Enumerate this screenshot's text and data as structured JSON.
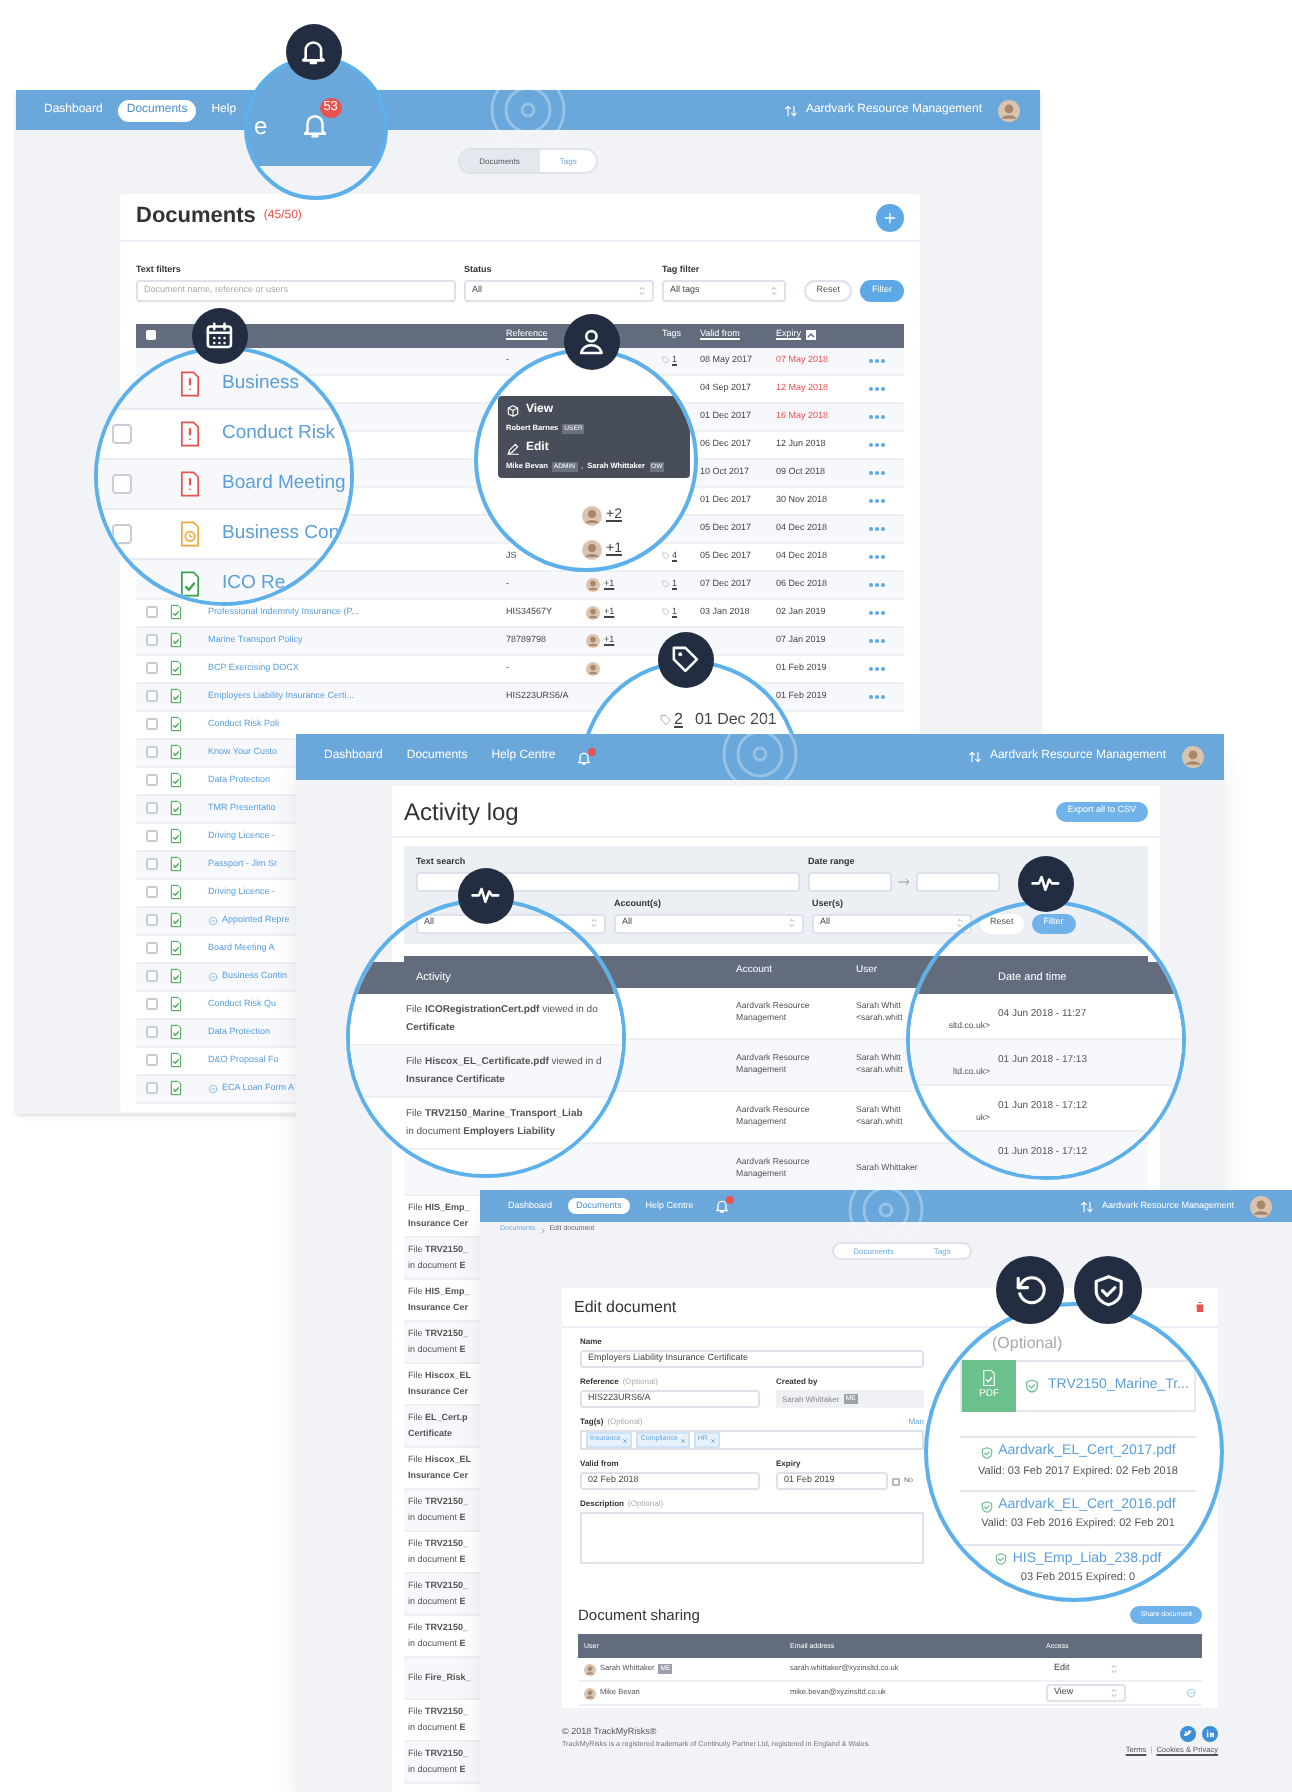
{
  "documents_window": {
    "nav": {
      "links": [
        {
          "label": "Dashboard",
          "selected": false
        },
        {
          "label": "Documents",
          "selected": true
        },
        {
          "label": "Help",
          "selected": false
        }
      ],
      "account": "Aardvark Resource Management"
    },
    "view_toggle": [
      {
        "label": "Documents",
        "selected": true
      },
      {
        "label": "Tags",
        "selected": false
      }
    ],
    "title": "Documents",
    "count": "(45/50)",
    "filters": {
      "text_label": "Text filters",
      "text_placeholder": "Document name, reference or users",
      "status_label": "Status",
      "status_value": "All",
      "tag_label": "Tag filter",
      "tag_value": "All tags",
      "reset": "Reset",
      "filter": "Filter"
    },
    "select_all_checked": false,
    "columns": {
      "reference": "Reference",
      "tags": "Tags",
      "valid_from": "Valid from",
      "expiry": "Expiry"
    },
    "rows": [
      {
        "reference": "-",
        "tags": "1",
        "valid_from": "08 May 2017",
        "expiry": "07 May 2018",
        "expired": true
      },
      {
        "valid_from": "04 Sep 2017",
        "expiry": "12 May 2018",
        "expired": true
      },
      {
        "valid_from": "01 Dec 2017",
        "expiry": "16 May 2018",
        "expired": true
      },
      {
        "valid_from": "06 Dec 2017",
        "expiry": "12 Jun 2018",
        "expired": false
      },
      {
        "valid_from": "10 Oct 2017",
        "expiry": "09 Oct 2018",
        "expired": false
      },
      {
        "valid_from": "01 Dec 2017",
        "expiry": "30 Nov 2018",
        "expired": false
      },
      {
        "valid_from": "05 Dec 2017",
        "expiry": "04 Dec 2018",
        "expired": false
      },
      {
        "reference": "JS",
        "tags": "4",
        "valid_from": "05 Dec 2017",
        "expiry": "04 Dec 2018",
        "expired": false
      },
      {
        "reference": "-",
        "users": "+1",
        "tags": "1",
        "valid_from": "07 Dec 2017",
        "expiry": "06 Dec 2018",
        "expired": false
      },
      {
        "checked": false,
        "kind": "valid",
        "name": "Professional Indemnity Insurance (P...",
        "reference": "HIS34567Y",
        "users": "+1",
        "tags": "1",
        "valid_from": "03 Jan 2018",
        "expiry": "02 Jan 2019",
        "expired": false
      },
      {
        "checked": false,
        "kind": "valid",
        "name": "Marine Transport Policy",
        "reference": "78789798",
        "users": "+1",
        "expiry": "07 Jan 2019",
        "expired": false
      },
      {
        "checked": false,
        "kind": "valid",
        "name": "BCP Exercising DOCX",
        "reference": "-",
        "users": "",
        "expiry": "01 Feb 2019",
        "expired": false
      },
      {
        "checked": false,
        "kind": "valid",
        "name": "Employers Liability Insurance Certi...",
        "reference": "HIS223URS6/A",
        "expiry": "01 Feb 2019",
        "expired": false
      },
      {
        "checked": false,
        "kind": "valid",
        "name": "Conduct Risk Poli"
      },
      {
        "checked": false,
        "kind": "valid",
        "name": "Know Your Custo"
      },
      {
        "checked": false,
        "kind": "valid",
        "name": "Data Protection"
      },
      {
        "checked": false,
        "kind": "valid",
        "name": "TMR Presentatio"
      },
      {
        "checked": false,
        "kind": "valid",
        "name": "Driving Licence -"
      },
      {
        "checked": false,
        "kind": "valid",
        "name": "Passport - Jim Sr"
      },
      {
        "checked": false,
        "kind": "valid",
        "name": "Driving Licence -"
      },
      {
        "checked": false,
        "kind": "valid",
        "linked": true,
        "name": "Appointed Repre"
      },
      {
        "checked": false,
        "kind": "valid",
        "name": "Board Meeting A"
      },
      {
        "checked": false,
        "kind": "valid",
        "linked": true,
        "name": "Business Contin"
      },
      {
        "checked": false,
        "kind": "valid",
        "name": "Conduct Risk Qu"
      },
      {
        "checked": false,
        "kind": "valid",
        "name": "Data Protection"
      },
      {
        "checked": false,
        "kind": "valid",
        "name": "D&O Proposal Fo"
      },
      {
        "checked": false,
        "kind": "valid",
        "linked": true,
        "name": "ECA Loan Form A"
      }
    ]
  },
  "bell_magnifier": {
    "nav_fragment": "e",
    "badge": "53"
  },
  "status_magnifier": {
    "rows": [
      {
        "kind": "overdue",
        "name": "Business"
      },
      {
        "checked": false,
        "kind": "overdue",
        "name": "Conduct Risk"
      },
      {
        "checked": false,
        "kind": "overdue",
        "name": "Board Meeting"
      },
      {
        "checked": false,
        "kind": "pending",
        "name": "Business Con"
      },
      {
        "kind": "valid",
        "name": "ICO Re"
      }
    ]
  },
  "users_magnifier": {
    "permissions": [
      {
        "action": "View",
        "users": [
          {
            "name": "Robert Barnes",
            "role": "USER"
          }
        ]
      },
      {
        "action": "Edit",
        "users": [
          {
            "name": "Mike Bevan",
            "role": "ADMIN"
          },
          {
            "separator": ",",
            "name": "Sarah Whittaker",
            "role": "OW"
          }
        ]
      }
    ],
    "counts": [
      "+2",
      "+1"
    ]
  },
  "tags_magnifier": {
    "tags": "2",
    "date": "01 Dec 201"
  },
  "activity_window": {
    "nav": {
      "links": [
        {
          "label": "Dashboard",
          "selected": false
        },
        {
          "label": "Documents",
          "selected": false
        },
        {
          "label": "Help Centre",
          "selected": false
        }
      ],
      "notification": true,
      "account": "Aardvark Resource Management"
    },
    "title": "Activity log",
    "export": "Export all to CSV",
    "filters": {
      "text_label": "Text search",
      "date_label": "Date range",
      "type_value": "All",
      "account_label": "Account(s)",
      "account_value": "All",
      "user_label": "User(s)",
      "user_value": "All",
      "reset": "Reset",
      "filter": "Filter"
    },
    "columns": {
      "activity": "Activity",
      "account": "Account",
      "user": "User",
      "date": "Date and time"
    },
    "rows": [
      {
        "kind": "full",
        "account": "Aardvark Resource Management",
        "user_name": "Sarah Whitt",
        "user_email": "<sarah.whitt"
      },
      {
        "kind": "full",
        "account": "Aardvark Resource Management",
        "user_name": "Sarah Whitt",
        "user_email": "<sarah.whitt"
      },
      {
        "kind": "full",
        "account": "Aardvark Resource Management",
        "user_name": "Sarah Whitt",
        "user_email": "<sarah.whitt"
      },
      {
        "kind": "full",
        "account": "Aardvark Resource Management",
        "user_name": "Sarah Whittaker"
      },
      {
        "kind": "partial",
        "lines": [
          "File **HIS_Emp_**",
          "**Insurance Cer**"
        ]
      },
      {
        "kind": "partial",
        "lines": [
          "File **TRV2150_**",
          "in document **E**"
        ]
      },
      {
        "kind": "partial",
        "lines": [
          "File **HIS_Emp_**",
          "**Insurance Cer**"
        ]
      },
      {
        "kind": "partial",
        "lines": [
          "File **TRV2150_**",
          "in document **E**"
        ]
      },
      {
        "kind": "partial",
        "lines": [
          "File **Hiscox_EL**",
          "**Insurance Cer**"
        ]
      },
      {
        "kind": "partial",
        "lines": [
          "File **EL_Cert.p**",
          "**Certificate**"
        ]
      },
      {
        "kind": "partial",
        "lines": [
          "File **Hiscox_EL**",
          "**Insurance Cer**"
        ]
      },
      {
        "kind": "partial",
        "lines": [
          "File **TRV2150_**",
          "in document **E**"
        ]
      },
      {
        "kind": "partial",
        "lines": [
          "File **TRV2150_**",
          "in document **E**"
        ]
      },
      {
        "kind": "partial",
        "lines": [
          "File **TRV2150_**",
          "in document **E**"
        ]
      },
      {
        "kind": "partial",
        "lines": [
          "File **TRV2150_**",
          "in document **E**"
        ]
      },
      {
        "kind": "partial",
        "lines": [
          "File **Fire_Risk_**"
        ]
      },
      {
        "kind": "partial",
        "lines": [
          "File **TRV2150_**",
          "in document **E**"
        ]
      },
      {
        "kind": "partial",
        "lines": [
          "File **TRV2150_**",
          "in document **E**"
        ]
      }
    ]
  },
  "activity_magnifier": {
    "entries": [
      [
        "File **ICORegistrationCert.pdf** viewed in do",
        "**Certificate**"
      ],
      [
        "File **Hiscox_EL_Certificate.pdf** viewed in d",
        "**Insurance Certificate**"
      ],
      [
        "File **TRV2150_Marine_Transport_Liab**",
        "in document **Employers Liability**"
      ]
    ]
  },
  "date_magnifier": {
    "entries": [
      {
        "tail": "sltd.co.uk>",
        "date": "04 Jun 2018 - 11:27"
      },
      {
        "tail": "ltd.co.uk>",
        "date": "01 Jun 2018 - 17:13"
      },
      {
        "tail": "uk>",
        "date": "01 Jun 2018 - 17:12"
      },
      {
        "date": "01 Jun 2018 - 17:12"
      }
    ]
  },
  "edit_window": {
    "nav": {
      "links": [
        {
          "label": "Dashboard",
          "selected": false
        },
        {
          "label": "Documents",
          "selected": true
        },
        {
          "label": "Help Centre",
          "selected": false
        }
      ],
      "notification": true,
      "account": "Aardvark Resource Management"
    },
    "breadcrumb": [
      "Documents",
      "Edit document"
    ],
    "view_toggle": [
      {
        "label": "Documents",
        "selected": false
      },
      {
        "label": "Tags",
        "selected": false
      }
    ],
    "title": "Edit document",
    "name_label": "Name",
    "name_value": "Employers Liability Insurance Certificate",
    "reference_label": "Reference",
    "reference_hint": "(Optional)",
    "reference_value": "HIS223URS6/A",
    "created_label": "Created by",
    "created_value": "Sarah Whittaker",
    "created_badge": "ME",
    "tags_label": "Tag(s)",
    "tags_hint": "(Optional)",
    "manage_link": "Man",
    "tags": [
      "Insurance",
      "Compliance",
      "HR"
    ],
    "valid_label": "Valid from",
    "valid_value": "02 Feb 2018",
    "expiry_label": "Expiry",
    "expiry_value": "01 Feb 2019",
    "no_expiry_checked": false,
    "no_expiry_label": "No",
    "description_label": "Description",
    "description_hint": "(Optional)",
    "sharing_title": "Document sharing",
    "share_button": "Share document",
    "sharing_columns": [
      "User",
      "Email address",
      "Access"
    ],
    "sharing_rows": [
      {
        "user": "Sarah Whittaker",
        "badge": "ME",
        "email": "sarah.whittaker@xyzinsltd.co.uk",
        "access": "Edit",
        "disabled": true
      },
      {
        "user": "Mike Bevan",
        "email": "mike.bevan@xyzinsltd.co.uk",
        "access": "View",
        "disabled": false
      }
    ],
    "footer": {
      "copyright": "© 2018 TrackMyRisks®",
      "legal": "TrackMyRisks is a registered trademark of Continuity Partner Ltd, registered in England & Wales.",
      "links": [
        "Terms",
        "Cookies & Privacy"
      ],
      "separator": "|"
    }
  },
  "files_magnifier": {
    "hint": "(Optional)",
    "thumbnail": "PDF",
    "current": "TRV2150_Marine_Tr...",
    "versions": [
      {
        "name": "Aardvark_EL_Cert_2017.pdf",
        "dates": "Valid: 03 Feb 2017 Expired: 02 Feb 2018"
      },
      {
        "name": "Aardvark_EL_Cert_2016.pdf",
        "dates": "Valid: 03 Feb 2016 Expired: 02 Feb 201"
      },
      {
        "name": "HIS_Emp_Liab_238.pdf",
        "dates": "03 Feb 2015 Expired: 0"
      }
    ]
  }
}
